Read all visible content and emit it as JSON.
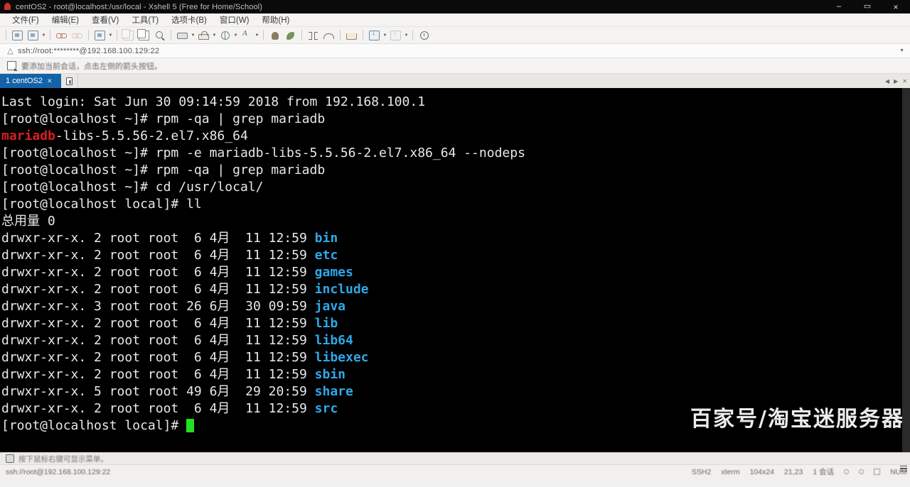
{
  "window": {
    "title": "centOS2 - root@localhost:/usr/local - Xshell 5 (Free for Home/School)",
    "app_icon": "xshell-icon",
    "minimize": "–",
    "maximize": "▭",
    "close": "×"
  },
  "menu": {
    "items": [
      {
        "label": "文件(F)",
        "name": "menu-file"
      },
      {
        "label": "编辑(E)",
        "name": "menu-edit"
      },
      {
        "label": "查看(V)",
        "name": "menu-view"
      },
      {
        "label": "工具(T)",
        "name": "menu-tools"
      },
      {
        "label": "选项卡(B)",
        "name": "menu-tabs"
      },
      {
        "label": "窗口(W)",
        "name": "menu-window"
      },
      {
        "label": "帮助(H)",
        "name": "menu-help"
      }
    ]
  },
  "toolbar": {
    "icons": [
      "new-session-icon",
      "open-sessions-icon",
      "connect-icon",
      "disconnect-icon",
      "log-icon",
      "paste-icon",
      "copy-icon",
      "find-icon",
      "print-icon",
      "lock-icon",
      "globe-icon",
      "font-icon",
      "mouse-icon",
      "leaf-icon",
      "fullscreen-icon",
      "headset-icon",
      "folder-transfer-icon",
      "download-icon",
      "upload-icon",
      "history-icon"
    ]
  },
  "address": {
    "warning_icon": "warning-icon",
    "value": "ssh://root:********@192.168.100.129:22",
    "dropdown_icon": "chevron-down-icon"
  },
  "notice": {
    "icon": "add-session-icon",
    "text": "要添加当前会话，点击左侧的箭头按钮。"
  },
  "tabs": {
    "active": {
      "label": "1 centOS2",
      "close_icon": "close-icon"
    },
    "new_tab_icon": "new-tab-icon",
    "right_icons": [
      "chevron-left-icon",
      "chevron-right-icon",
      "close-icon"
    ]
  },
  "terminal": {
    "lines": [
      {
        "segments": [
          {
            "text": "Last login: Sat Jun 30 09:14:59 2018 from 192.168.100.1",
            "color": "default"
          }
        ]
      },
      {
        "segments": [
          {
            "text": "[root@localhost ~]# rpm -qa | grep mariadb",
            "color": "default"
          }
        ]
      },
      {
        "segments": [
          {
            "text": "mariadb",
            "color": "red"
          },
          {
            "text": "-libs-5.5.56-2.el7.x86_64",
            "color": "default"
          }
        ]
      },
      {
        "segments": [
          {
            "text": "[root@localhost ~]# rpm -e mariadb-libs-5.5.56-2.el7.x86_64 --nodeps",
            "color": "default"
          }
        ]
      },
      {
        "segments": [
          {
            "text": "[root@localhost ~]# rpm -qa | grep mariadb",
            "color": "default"
          }
        ]
      },
      {
        "segments": [
          {
            "text": "[root@localhost ~]# cd /usr/local/",
            "color": "default"
          }
        ]
      },
      {
        "segments": [
          {
            "text": "[root@localhost local]# ll",
            "color": "default"
          }
        ]
      },
      {
        "segments": [
          {
            "text": "总用量 0",
            "color": "default"
          }
        ]
      },
      {
        "segments": [
          {
            "text": "drwxr-xr-x. 2 root root  6 4月  11 12:59 ",
            "color": "default"
          },
          {
            "text": "bin",
            "color": "dir"
          }
        ]
      },
      {
        "segments": [
          {
            "text": "drwxr-xr-x. 2 root root  6 4月  11 12:59 ",
            "color": "default"
          },
          {
            "text": "etc",
            "color": "dir"
          }
        ]
      },
      {
        "segments": [
          {
            "text": "drwxr-xr-x. 2 root root  6 4月  11 12:59 ",
            "color": "default"
          },
          {
            "text": "games",
            "color": "dir"
          }
        ]
      },
      {
        "segments": [
          {
            "text": "drwxr-xr-x. 2 root root  6 4月  11 12:59 ",
            "color": "default"
          },
          {
            "text": "include",
            "color": "dir"
          }
        ]
      },
      {
        "segments": [
          {
            "text": "drwxr-xr-x. 3 root root 26 6月  30 09:59 ",
            "color": "default"
          },
          {
            "text": "java",
            "color": "dir"
          }
        ]
      },
      {
        "segments": [
          {
            "text": "drwxr-xr-x. 2 root root  6 4月  11 12:59 ",
            "color": "default"
          },
          {
            "text": "lib",
            "color": "dir"
          }
        ]
      },
      {
        "segments": [
          {
            "text": "drwxr-xr-x. 2 root root  6 4月  11 12:59 ",
            "color": "default"
          },
          {
            "text": "lib64",
            "color": "dir"
          }
        ]
      },
      {
        "segments": [
          {
            "text": "drwxr-xr-x. 2 root root  6 4月  11 12:59 ",
            "color": "default"
          },
          {
            "text": "libexec",
            "color": "dir"
          }
        ]
      },
      {
        "segments": [
          {
            "text": "drwxr-xr-x. 2 root root  6 4月  11 12:59 ",
            "color": "default"
          },
          {
            "text": "sbin",
            "color": "dir"
          }
        ]
      },
      {
        "segments": [
          {
            "text": "drwxr-xr-x. 5 root root 49 6月  29 20:59 ",
            "color": "default"
          },
          {
            "text": "share",
            "color": "dir"
          }
        ]
      },
      {
        "segments": [
          {
            "text": "drwxr-xr-x. 2 root root  6 4月  11 12:59 ",
            "color": "default"
          },
          {
            "text": "src",
            "color": "dir"
          }
        ]
      },
      {
        "segments": [
          {
            "text": "[root@localhost local]# ",
            "color": "default"
          },
          {
            "text": "",
            "color": "cursor"
          }
        ]
      }
    ],
    "colors": {
      "background": "#000000",
      "foreground": "#e8e8e8",
      "directory": "#2fa8e8",
      "match_highlight": "#d62020",
      "cursor": "#22e022"
    }
  },
  "watermark": {
    "text": "百家号/淘宝迷服务器"
  },
  "hint": {
    "icon": "tip-icon",
    "text": "按下鼠标右键可显示菜单。"
  },
  "status": {
    "connection": "ssh://root@192.168.100.129:22",
    "protocol": "SSH2",
    "terminal_type": "xterm",
    "size": "104x24",
    "cursor_position": "21,23",
    "session_label": "1 会话",
    "caps_indicator": "NUM",
    "icons": [
      "circle-icon",
      "circle-icon",
      "capture-icon",
      "key-icon"
    ]
  }
}
